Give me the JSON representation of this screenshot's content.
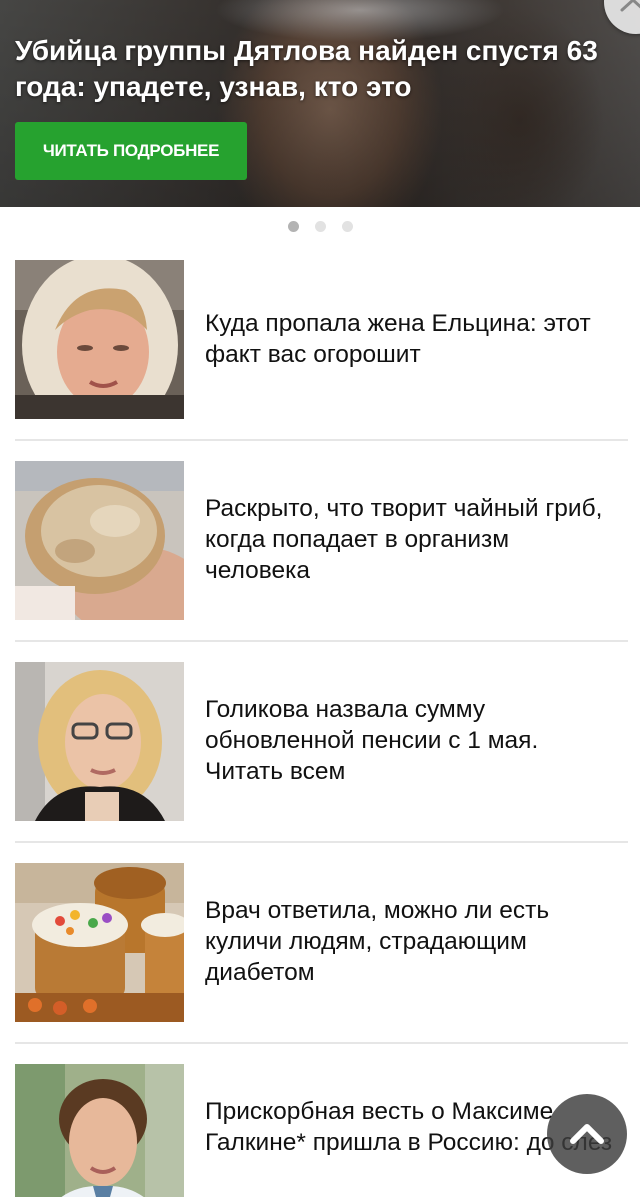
{
  "hero": {
    "title": "Убийца группы Дятлова найден спустя 63 года: упадете, узнав, кто это",
    "button_label": "ЧИТАТЬ ПОДРОБНЕЕ",
    "dots_total": 3,
    "dots_active": 1
  },
  "articles": [
    {
      "title": "Куда пропала жена Ельцина: этот факт вас огорошит",
      "thumb": "woman-in-headscarf-photo"
    },
    {
      "title": "Раскрыто, что творит чайный гриб, когда попадает в организм человека",
      "thumb": "kombucha-in-hand-photo"
    },
    {
      "title": "Голикова назвала сумму обновленной пенсии с 1 мая. Читать всем",
      "thumb": "blonde-woman-glasses-photo"
    },
    {
      "title": "Врач ответила, можно ли есть куличи людям, страдающим диабетом",
      "thumb": "easter-cakes-photo"
    },
    {
      "title": "Прискорбная весть о Максиме Галкине* пришла в Россию: до слез",
      "thumb": "man-portrait-photo"
    }
  ],
  "controls": {
    "scroll_top_icon": "chevron-up-icon",
    "corner_icon": "chevron-up-icon"
  },
  "colors": {
    "accent_green": "#26a22f",
    "text": "#111111",
    "divider": "#e6e6e6"
  }
}
